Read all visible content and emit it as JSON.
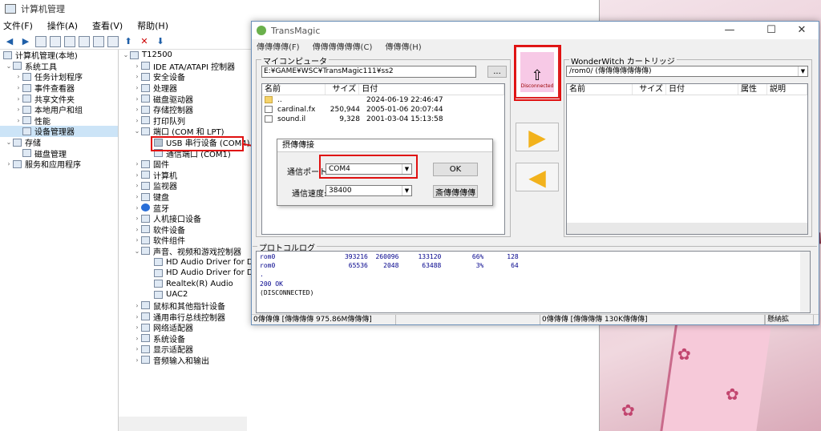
{
  "computer_management": {
    "title": "计算机管理",
    "menu": [
      "文件(F)",
      "操作(A)",
      "查看(V)",
      "帮助(H)"
    ],
    "left_tree": [
      {
        "label": "计算机管理(本地)",
        "level": 0
      },
      {
        "label": "系统工具",
        "level": 1
      },
      {
        "label": "任务计划程序",
        "level": 2
      },
      {
        "label": "事件查看器",
        "level": 2
      },
      {
        "label": "共享文件夹",
        "level": 2
      },
      {
        "label": "本地用户和组",
        "level": 2
      },
      {
        "label": "性能",
        "level": 2
      },
      {
        "label": "设备管理器",
        "level": 2,
        "selected": true
      },
      {
        "label": "存储",
        "level": 1
      },
      {
        "label": "磁盘管理",
        "level": 2
      },
      {
        "label": "服务和应用程序",
        "level": 1
      }
    ],
    "device_tree": [
      "T12500",
      "IDE ATA/ATAPI 控制器",
      "安全设备",
      "处理器",
      "磁盘驱动器",
      "存储控制器",
      "打印队列",
      "端口 (COM 和 LPT)",
      "USB 串行设备 (COM4)",
      "通信端口 (COM1)",
      "固件",
      "计算机",
      "监视器",
      "键盘",
      "蓝牙",
      "人机接口设备",
      "软件设备",
      "软件组件",
      "声音、视频和游戏控制器",
      "HD Audio Driver for Displ",
      "HD Audio Driver for Displ",
      "Realtek(R) Audio",
      "UAC2",
      "鼠标和其他指针设备",
      "通用串行总线控制器",
      "网络适配器",
      "系统设备",
      "显示适配器",
      "音频输入和输出"
    ]
  },
  "transmagic": {
    "title": "TransMagic",
    "menu": [
      "傳傳傳傳(F)",
      "傳傳傳傳傳傳(C)",
      "傳傳傳(H)"
    ],
    "pc_group_label": "マイコンピュータ",
    "pc_path": "E:¥GAME¥WSC¥TransMagic111¥ss2",
    "browse_button": "...",
    "pc_columns": [
      "名前",
      "サイズ",
      "日付"
    ],
    "pc_files": [
      {
        "name": "..",
        "size": "",
        "date": "2024-06-19 22:46:47",
        "folder": true
      },
      {
        "name": "cardinal.fx",
        "size": "250,944",
        "date": "2005-01-06 20:07:44"
      },
      {
        "name": "sound.il",
        "size": "9,328",
        "date": "2001-03-04 15:13:58"
      }
    ],
    "connect_label": "Disconnected",
    "ww_group_label": "WonderWitch カートリッジ",
    "ww_path": "/rom0/ (傳傳傳傳傳傳傳)",
    "ww_columns": [
      "名前",
      "サイズ",
      "日付",
      "属性",
      "説明"
    ],
    "log_group_label": "プロトコルログ",
    "log_lines": [
      "rom0                  393216  260096     133120        66%      128",
      "rom0                   65536    2048      63488         3%       64",
      ".",
      "200 OK",
      "(DISCONNECTED)"
    ],
    "status": [
      "0傳傳傳 [傳傳傳傳 975.86M傳傳傳]",
      "",
      "0傳傳傳 [傳傳傳傳 130K傳傳傳]",
      "",
      "懸納拡"
    ]
  },
  "dialog": {
    "title": "摂傳傳接",
    "port_label": "通信ポート:",
    "port_value": "COM4",
    "speed_label": "通信速度:",
    "speed_value": "38400",
    "ok_button": "OK",
    "save_button": "斎傳傳傳傳"
  },
  "colors": {
    "accent_red": "#e01010",
    "arrow_yellow": "#f2b21c",
    "log_blue": "#00008b"
  }
}
